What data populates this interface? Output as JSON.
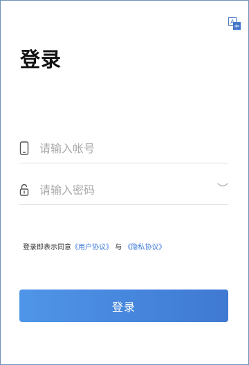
{
  "header": {
    "title": "登录",
    "translate_icon": "translate-icon"
  },
  "form": {
    "account": {
      "icon": "phone-icon",
      "placeholder": "请输入帐号",
      "value": ""
    },
    "password": {
      "icon": "lock-icon",
      "placeholder": "请输入密码",
      "value": "",
      "toggle_icon": "eye-closed-icon"
    }
  },
  "agreement": {
    "prefix": "登录即表示同意",
    "user_agreement": "《用户协议》",
    "connector": "与",
    "privacy_policy": "《隐私协议》"
  },
  "actions": {
    "login_label": "登录"
  },
  "colors": {
    "accent": "#3f7bd9",
    "button_start": "#4f95e8",
    "button_end": "#3f79d2",
    "border": "#6f8fb7"
  }
}
